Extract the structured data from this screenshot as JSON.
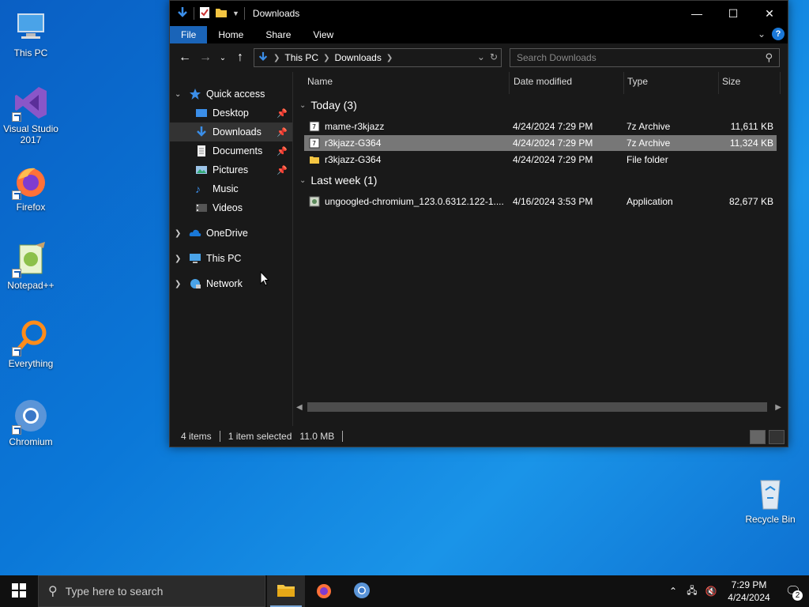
{
  "desktop": {
    "icons": [
      {
        "label": "This PC"
      },
      {
        "label": "Visual Studio 2017"
      },
      {
        "label": "Firefox"
      },
      {
        "label": "Notepad++"
      },
      {
        "label": "Everything"
      },
      {
        "label": "Chromium"
      },
      {
        "label": "Recycle Bin"
      }
    ]
  },
  "window": {
    "title": "Downloads",
    "ribbon_tabs": [
      "File",
      "Home",
      "Share",
      "View"
    ],
    "address": {
      "crumbs": [
        "This PC",
        "Downloads"
      ]
    },
    "search_placeholder": "Search Downloads",
    "sidebar": {
      "items": [
        {
          "label": "Quick access"
        },
        {
          "label": "Desktop"
        },
        {
          "label": "Downloads"
        },
        {
          "label": "Documents"
        },
        {
          "label": "Pictures"
        },
        {
          "label": "Music"
        },
        {
          "label": "Videos"
        },
        {
          "label": "OneDrive"
        },
        {
          "label": "This PC"
        },
        {
          "label": "Network"
        }
      ]
    },
    "columns": [
      "Name",
      "Date modified",
      "Type",
      "Size"
    ],
    "groups": [
      {
        "label": "Today (3)"
      },
      {
        "label": "Last week (1)"
      }
    ],
    "files": [
      {
        "name": "mame-r3kjazz",
        "date": "4/24/2024 7:29 PM",
        "type": "7z Archive",
        "size": "11,611 KB"
      },
      {
        "name": "r3kjazz-G364",
        "date": "4/24/2024 7:29 PM",
        "type": "7z Archive",
        "size": "11,324 KB"
      },
      {
        "name": "r3kjazz-G364",
        "date": "4/24/2024 7:29 PM",
        "type": "File folder",
        "size": ""
      },
      {
        "name": "ungoogled-chromium_123.0.6312.122-1....",
        "date": "4/16/2024 3:53 PM",
        "type": "Application",
        "size": "82,677 KB"
      }
    ],
    "status": {
      "items": "4 items",
      "selected": "1 item selected",
      "size": "11.0 MB"
    }
  },
  "taskbar": {
    "search_placeholder": "Type here to search",
    "time": "7:29 PM",
    "date": "4/24/2024",
    "notifications": "2"
  },
  "colors": {
    "accent": "#1a64b8",
    "window_bg": "#191919",
    "selected_row": "#777777"
  }
}
